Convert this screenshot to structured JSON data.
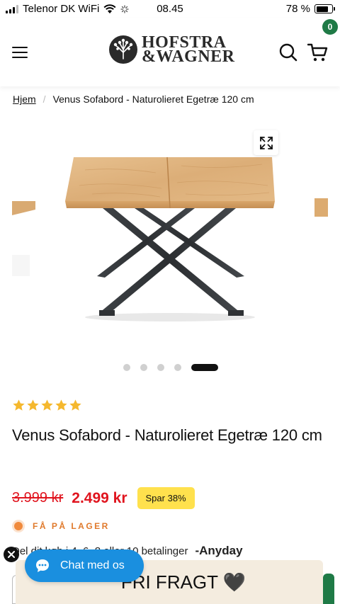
{
  "status_bar": {
    "carrier": "Telenor DK WiFi",
    "time": "08.45",
    "battery_percent": "78 %",
    "battery_level": 0.78
  },
  "header": {
    "logo_line1": "HOFSTRA",
    "logo_line2": "&WAGNER",
    "cart_count": "0",
    "icons": {
      "menu": "hamburger-icon",
      "search": "search-icon",
      "cart": "cart-icon"
    },
    "colors": {
      "badge": "#1f7a46"
    }
  },
  "breadcrumb": {
    "home": "Hjem",
    "separator": "/",
    "current": "Venus Sofabord - Naturolieret Egetræ 120 cm"
  },
  "gallery": {
    "image_count": 5,
    "active_index": 4,
    "expand_icon": "expand-icon"
  },
  "product": {
    "rating_stars": 5,
    "title": "Venus Sofabord - Naturolieret Egetræ 120 cm",
    "old_price": "3.999 kr",
    "new_price": "2.499 kr",
    "save_badge": "Spar 38%",
    "stock_status": "FÅ PÅ LAGER",
    "installments_text": "Del dit køb i 4, 6, 8 eller 10 betalinger",
    "installments_brand": "Anyday",
    "colors": {
      "price": "#e0141e",
      "badge": "#ffe14d",
      "stock": "#e07a2c",
      "star": "#f5b82e"
    }
  },
  "banner": {
    "text": "FRI FRAGT 🖤"
  },
  "chat": {
    "label": "Chat med os",
    "color": "#1a8fdf"
  }
}
